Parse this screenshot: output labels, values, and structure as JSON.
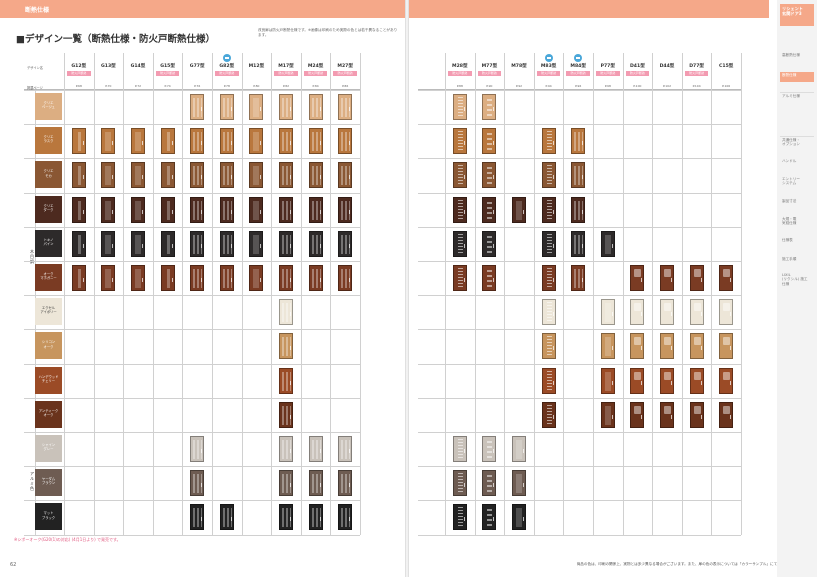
{
  "section_tab": "断熱仕様",
  "page_title": "■デザイン一覧（断熱仕様・防火戸断熱仕様）",
  "page_note": "改良扉は防火戸断熱仕様です。※画像は印刷のため実際の色とは若干異なることがあります。",
  "page_numbers": {
    "left": "62",
    "right": "63"
  },
  "footnote": "※シポーオーク(G20(1)の対応) (4月1日より) で発売です。",
  "right_note": "商品の色は、印刷の関係上、実物とは多少異なる場合がございます。また、扉の色の表示については「カラーサンプル」にてご確認ください。",
  "header_labels": {
    "design": "デザイン名",
    "page": "掲載ページ"
  },
  "sidebar": {
    "header": "リシェント\n玄関ドア3",
    "items": [
      "高断熱仕様",
      "断熱仕様",
      "アルミ仕様",
      "共通仕様・\nオプション",
      "ハンドル",
      "エントリー\nシステム",
      "製品寸法",
      "大規・電\n気錠仕様",
      "仕様表",
      "施工手順",
      "LIXIL\n(リクシル) 施工\n仕様"
    ]
  },
  "categories": [
    {
      "label": "木目調",
      "rows": 10
    },
    {
      "label": "アルミ色",
      "rows": 3
    }
  ],
  "colors": [
    {
      "label": "クリエ\nベージュ",
      "color": "#dcae82",
      "dark": false
    },
    {
      "label": "クリエ\nラスク",
      "color": "#b9773d",
      "dark": false
    },
    {
      "label": "クリエ\nモカ",
      "color": "#8a5733",
      "dark": false
    },
    {
      "label": "クリエ\nダーク",
      "color": "#4d2a1f",
      "dark": false
    },
    {
      "label": "トキノ\nパイン",
      "color": "#2d2a2a",
      "dark": false
    },
    {
      "label": "オーク\nマホガニー",
      "color": "#7a3b23",
      "dark": false
    },
    {
      "label": "エクセル\nアイボリー",
      "color": "#ede6d8",
      "dark": true
    },
    {
      "label": "シリコン\nオーク",
      "color": "#c7955e",
      "dark": false
    },
    {
      "label": "ハンデウッド\nチェリー",
      "color": "#9b4b26",
      "dark": false
    },
    {
      "label": "アンティーク\nオーク",
      "color": "#6a331c",
      "dark": false
    },
    {
      "label": "シャイン\nグレー",
      "color": "#c9c2ba",
      "dark": false
    },
    {
      "label": "ヤーダム\nブラウン",
      "color": "#6e5c52",
      "dark": false
    },
    {
      "label": "マット\nブラック",
      "color": "#222222",
      "dark": false
    }
  ],
  "left_columns": [
    {
      "name": "G12型",
      "tag": "防火戸断熱",
      "page": "P.68",
      "badge": false
    },
    {
      "name": "G13型",
      "tag": "",
      "page": "P.70",
      "badge": false
    },
    {
      "name": "G14型",
      "tag": "",
      "page": "P.72",
      "badge": false
    },
    {
      "name": "G15型",
      "tag": "防火戸断熱",
      "page": "P.74",
      "badge": false
    },
    {
      "name": "G77型",
      "tag": "",
      "page": "P.76",
      "badge": false
    },
    {
      "name": "G82型",
      "tag": "防火戸断熱",
      "page": "P.78",
      "badge": true
    },
    {
      "name": "M12型",
      "tag": "",
      "page": "P.80",
      "badge": false
    },
    {
      "name": "M17型",
      "tag": "防火戸断熱",
      "page": "P.82",
      "badge": false
    },
    {
      "name": "M24型",
      "tag": "防火戸断熱",
      "page": "P.84",
      "badge": false
    },
    {
      "name": "M27型",
      "tag": "防火戸断熱",
      "page": "P.86",
      "badge": false
    }
  ],
  "right_columns": [
    {
      "name": "M28型",
      "tag": "防火戸断熱",
      "page": "P.88",
      "badge": false
    },
    {
      "name": "M77型",
      "tag": "防火戸断熱",
      "page": "P.90",
      "badge": false
    },
    {
      "name": "M78型",
      "tag": "",
      "page": "P.92",
      "badge": false
    },
    {
      "name": "M83型",
      "tag": "防火戸断熱",
      "page": "P.94",
      "badge": true
    },
    {
      "name": "M84型",
      "tag": "防火戸断熱",
      "page": "P.96",
      "badge": true
    },
    {
      "name": "P77型",
      "tag": "防火戸断熱",
      "page": "P.98",
      "badge": false
    },
    {
      "name": "D41型",
      "tag": "防火戸断熱",
      "page": "P.100",
      "badge": false
    },
    {
      "name": "D44型",
      "tag": "",
      "page": "P.102",
      "badge": false
    },
    {
      "name": "D77型",
      "tag": "防火戸断熱",
      "page": "P.104",
      "badge": false
    },
    {
      "name": "C15型",
      "tag": "",
      "page": "P.106",
      "badge": false
    }
  ],
  "left_availability": [
    [
      0,
      0,
      0,
      0,
      1,
      1,
      1,
      1,
      1,
      1
    ],
    [
      1,
      1,
      1,
      1,
      1,
      1,
      1,
      1,
      1,
      1
    ],
    [
      1,
      1,
      1,
      1,
      1,
      1,
      1,
      1,
      1,
      1
    ],
    [
      1,
      1,
      1,
      1,
      1,
      1,
      1,
      1,
      1,
      1
    ],
    [
      1,
      1,
      1,
      1,
      1,
      1,
      1,
      1,
      1,
      1
    ],
    [
      1,
      1,
      1,
      1,
      1,
      1,
      1,
      1,
      1,
      1
    ],
    [
      0,
      0,
      0,
      0,
      0,
      0,
      0,
      1,
      0,
      0
    ],
    [
      0,
      0,
      0,
      0,
      0,
      0,
      0,
      1,
      0,
      0
    ],
    [
      0,
      0,
      0,
      0,
      0,
      0,
      0,
      1,
      0,
      0
    ],
    [
      0,
      0,
      0,
      0,
      0,
      0,
      0,
      1,
      0,
      0
    ],
    [
      0,
      0,
      0,
      0,
      1,
      0,
      0,
      1,
      1,
      1
    ],
    [
      0,
      0,
      0,
      0,
      1,
      0,
      0,
      1,
      1,
      1
    ],
    [
      0,
      0,
      0,
      0,
      1,
      1,
      0,
      1,
      1,
      1
    ]
  ],
  "right_availability": [
    [
      1,
      1,
      0,
      0,
      0,
      0,
      0,
      0,
      0,
      0
    ],
    [
      1,
      1,
      0,
      1,
      1,
      0,
      0,
      0,
      0,
      0
    ],
    [
      1,
      1,
      0,
      1,
      1,
      0,
      0,
      0,
      0,
      0
    ],
    [
      1,
      1,
      1,
      1,
      1,
      0,
      0,
      0,
      0,
      0
    ],
    [
      1,
      1,
      0,
      1,
      1,
      1,
      0,
      0,
      0,
      0
    ],
    [
      1,
      1,
      0,
      1,
      1,
      0,
      1,
      1,
      1,
      1
    ],
    [
      0,
      0,
      0,
      1,
      0,
      1,
      1,
      1,
      1,
      1
    ],
    [
      0,
      0,
      0,
      1,
      0,
      1,
      1,
      1,
      1,
      1
    ],
    [
      0,
      0,
      0,
      1,
      0,
      1,
      1,
      1,
      1,
      1
    ],
    [
      0,
      0,
      0,
      1,
      0,
      1,
      1,
      1,
      1,
      1
    ],
    [
      1,
      1,
      1,
      0,
      0,
      0,
      0,
      0,
      0,
      0
    ],
    [
      1,
      1,
      1,
      0,
      0,
      0,
      0,
      0,
      0,
      0
    ],
    [
      1,
      1,
      1,
      0,
      0,
      0,
      0,
      0,
      0,
      0
    ]
  ],
  "left_styles": [
    "s1",
    "s2",
    "s2",
    "s1",
    "s3",
    "s3",
    "s2",
    "s3",
    "s3",
    "s3"
  ],
  "right_styles": [
    "s4",
    "s6",
    "s2",
    "s4",
    "s3",
    "s2",
    "s5",
    "s5",
    "s5",
    "s5"
  ]
}
